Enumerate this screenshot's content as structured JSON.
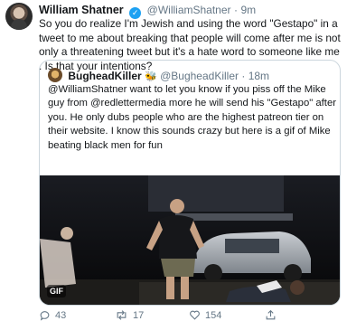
{
  "tweet": {
    "author_name": "William Shatner",
    "author_handle": "@WilliamShatner",
    "separator": "·",
    "time": "9m",
    "text": "So you do realize I'm Jewish and    using the word \"Gestapo\"  in a tweet to me about breaking that people will come after me is not only a threatening tweet but it's a hate word to someone like me . Is that your intentions?",
    "verified_icon": "verified-badge-icon"
  },
  "quote": {
    "author_name": "BugheadKiller",
    "author_emoji": "🐝",
    "author_handle": "@BugheadKiller",
    "separator": "·",
    "time": "18m",
    "text": "@WilliamShatner want to let you know if you piss off the Mike guy from @redlettermedia more he will send his \"Gestapo\" after you. He only dubs people who are the highest patreon tier on their website. I know this sounds crazy but here is a gif of Mike beating black men for fun",
    "media_badge": "GIF"
  },
  "actions": {
    "reply_count": "43",
    "retweet_count": "17",
    "like_count": "154"
  },
  "colors": {
    "text": "#14171a",
    "muted": "#657786",
    "border": "#ccd6dd",
    "verified": "#1da1f2"
  }
}
